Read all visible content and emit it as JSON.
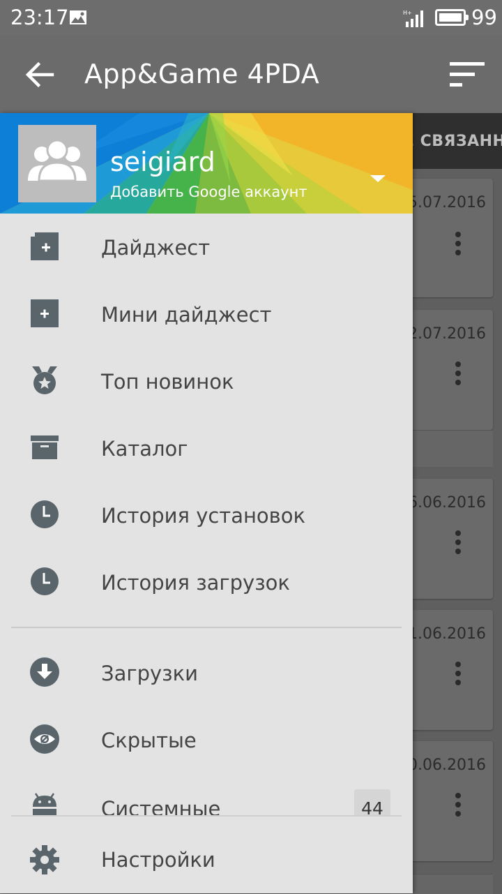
{
  "status_bar": {
    "time": "23:17",
    "network": "H+",
    "battery": "99"
  },
  "app_bar": {
    "title": "App&Game 4PDA"
  },
  "background": {
    "tab_label": "НЕ СВЯЗАНН",
    "dates": [
      "5.07.2016",
      "2.07.2016",
      "6.06.2016",
      "1.06.2016",
      "0.06.2016"
    ]
  },
  "drawer": {
    "username": "seigiard",
    "account_action": "Добавить Google аккаунт",
    "items": [
      {
        "label": "Дайджест",
        "icon": "digest-icon"
      },
      {
        "label": "Мини дайджест",
        "icon": "mini-digest-icon"
      },
      {
        "label": "Топ новинок",
        "icon": "medal-icon"
      },
      {
        "label": "Каталог",
        "icon": "archive-icon"
      },
      {
        "label": "История установок",
        "icon": "clock-icon"
      },
      {
        "label": "История загрузок",
        "icon": "clock-icon"
      },
      {
        "label": "Загрузки",
        "icon": "download-icon"
      },
      {
        "label": "Скрытые",
        "icon": "hidden-eye-icon"
      },
      {
        "label": "Системные",
        "icon": "android-icon",
        "badge": "44"
      },
      {
        "label": "Настройки",
        "icon": "gear-icon"
      }
    ]
  },
  "colors": {
    "icon": "#5a656b",
    "drawer_bg": "#e3e3e3",
    "toolbar": "#6b6b6b"
  }
}
